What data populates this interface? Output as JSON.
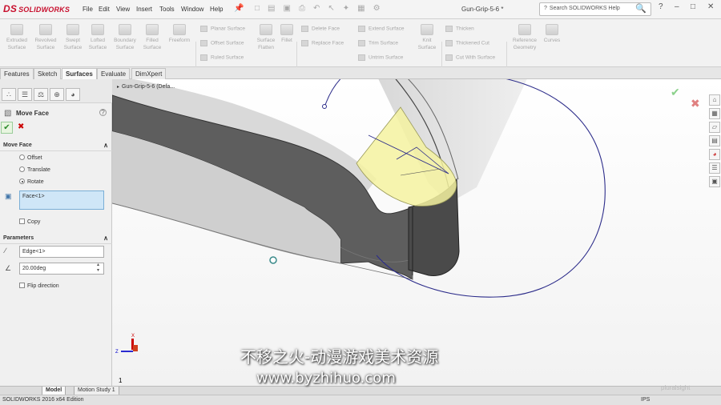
{
  "app": {
    "logo": "SOLIDWORKS",
    "logo_mark": "DS",
    "window_title": "Gun-Grip-5-6 *",
    "search_placeholder": "Search SOLIDWORKS Help"
  },
  "menus": [
    "File",
    "Edit",
    "View",
    "Insert",
    "Tools",
    "Window",
    "Help"
  ],
  "surface_tools": [
    "Extruded Surface",
    "Revolved Surface",
    "Swept Surface",
    "Lofted Surface",
    "Boundary Surface",
    "Filled Surface",
    "Freeform"
  ],
  "small_tools_a": [
    "Planar Surface",
    "Offset Surface",
    "Ruled Surface"
  ],
  "surface_flatten": "Surface Flatten",
  "fillet": "Fillet",
  "small_tools_b": [
    "Delete Face",
    "Replace Face"
  ],
  "small_tools_c": [
    "Extend Surface",
    "Trim Surface",
    "Untrim Surface"
  ],
  "knit": "Knit Surface",
  "small_tools_d": [
    "Thicken",
    "Thickened Cut",
    "Cut With Surface"
  ],
  "reference_geometry": "Reference Geometry",
  "curves": "Curves",
  "tabs": [
    "Features",
    "Sketch",
    "Surfaces",
    "Evaluate",
    "DimXpert"
  ],
  "active_tab": "Surfaces",
  "panel": {
    "title": "Move Face",
    "section_move": "Move Face",
    "options": [
      "Offset",
      "Translate",
      "Rotate"
    ],
    "selected_option": "Rotate",
    "face_value": "Face<1>",
    "copy_label": "Copy",
    "section_params": "Parameters",
    "edge_value": "Edge<1>",
    "angle_value": "20.00deg",
    "flip_label": "Flip direction"
  },
  "tree_label": "Gun-Grip-5-6  (Defa...",
  "triad": {
    "x": "X",
    "z": "Z"
  },
  "sheet_number": "1",
  "bottom_tabs": [
    "Model",
    "Motion Study 1"
  ],
  "status_text": "SOLIDWORKS 2016 x64 Edition",
  "status_units": "IPS",
  "watermark_line1": "不移之火-动漫游戏美术资源",
  "watermark_line2": "www.byzhihuo.com",
  "pluralsight": "pluralsight",
  "colors": {
    "accent_blue": "#2c2c8a",
    "face_highlight": "#f4f2a0",
    "model_dark": "#5f5f5f",
    "model_light": "#cfcfcf"
  }
}
